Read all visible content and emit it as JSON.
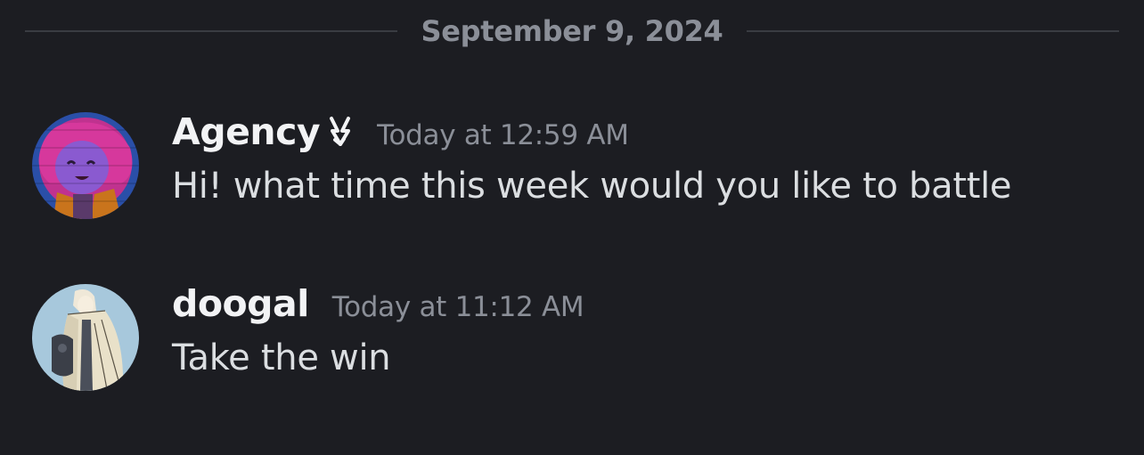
{
  "date_divider": {
    "label": "September 9, 2024"
  },
  "messages": [
    {
      "author": "Agency",
      "author_badge_icon": "lightning-bolt-icon",
      "timestamp": "Today at 12:59 AM",
      "content": "Hi! what time this week would you like to battle"
    },
    {
      "author": "doogal",
      "timestamp": "Today at 11:12 AM",
      "content": "Take the win"
    }
  ]
}
